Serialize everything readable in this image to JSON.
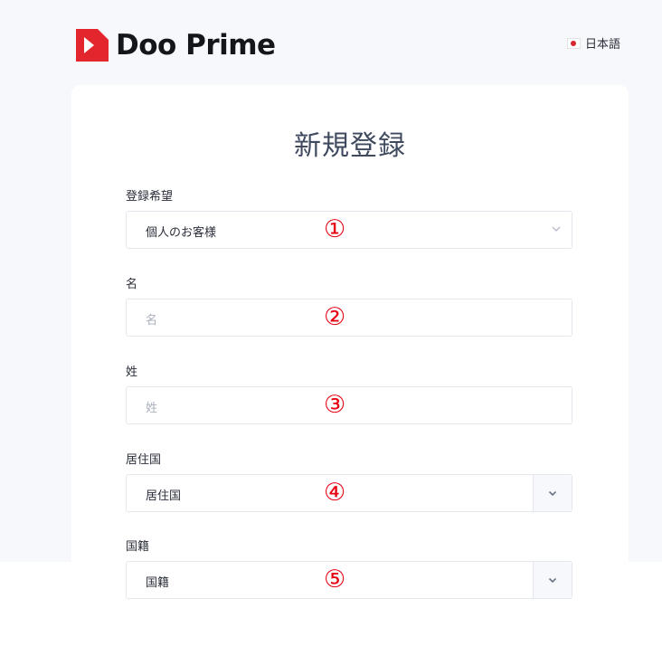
{
  "brand": {
    "name": "Doo Prime"
  },
  "header": {
    "language": "日本語"
  },
  "page": {
    "title": "新規登録"
  },
  "form": {
    "fields": [
      {
        "label": "登録希望",
        "value": "個人のお客様",
        "marker": "①"
      },
      {
        "label": "名",
        "placeholder": "名",
        "marker": "②"
      },
      {
        "label": "姓",
        "placeholder": "姓",
        "marker": "③"
      },
      {
        "label": "居住国",
        "value": "居住国",
        "marker": "④"
      },
      {
        "label": "国籍",
        "value": "国籍",
        "marker": "⑤"
      }
    ]
  },
  "colors": {
    "brand_red": "#e3262d",
    "marker_red": "#e60012",
    "title": "#3f4a5f"
  }
}
